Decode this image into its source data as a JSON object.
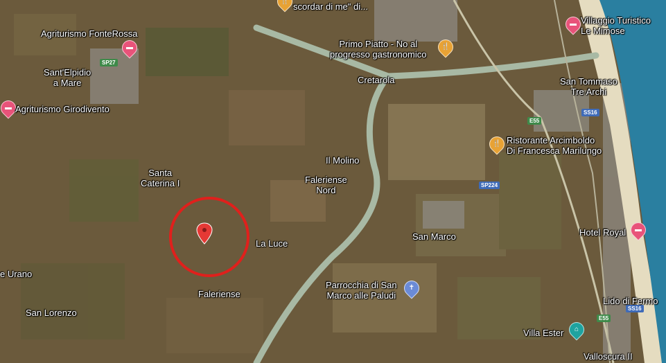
{
  "map": {
    "colors": {
      "farmland": "#6b5a3c",
      "river": "#a8b9a4",
      "sea": "#2a7fa0",
      "beach": "#e5dcc0",
      "urban": "#8d8a82",
      "marker": "#e53935",
      "circle": "#e0201c"
    }
  },
  "places": {
    "scordar": "scordar di me\" di...",
    "fonterossa": "Agriturismo FonteRossa",
    "santelpidio": "Sant'Elpidio\na Mare",
    "girodivento": "Agriturismo Girodivento",
    "primo_piatto": "Primo Piatto - No al\nprogresso gastronomico",
    "cretarola": "Cretarola",
    "mimose": "Villaggio Turistico\nLe Mimose",
    "san_tommaso": "San Tommaso\nTre Archi",
    "arcimboldo": "Ristorante Arcimboldo\nDi Francesca Marilungo",
    "il_molino": "Il Molino",
    "faleriense_nord": "Faleriense\nNord",
    "santa_caterina": "Santa\nCaterina I",
    "la_luce": "La Luce",
    "san_marco": "San Marco",
    "hotel_royal": "Hotel Royal",
    "urano": "e Urano",
    "parrocchia": "Parrocchia di San\nMarco alle Paludi",
    "faleriense": "Faleriense",
    "lido": "Lido di Fermo",
    "san_lorenzo": "San Lorenzo",
    "villa_ester": "Villa Ester",
    "valloscura": "Valloscura II"
  },
  "roads": {
    "sp27": "SP27",
    "e55_a": "E55",
    "ss16_a": "SS16",
    "sp224": "SP224",
    "e55_b": "E55",
    "ss16_b": "SS16"
  },
  "icons": {
    "hotel": "bed-icon",
    "restaurant": "fork-knife-icon",
    "church": "cross-icon",
    "attraction": "landmark-icon",
    "marker": "map-pin-icon"
  }
}
